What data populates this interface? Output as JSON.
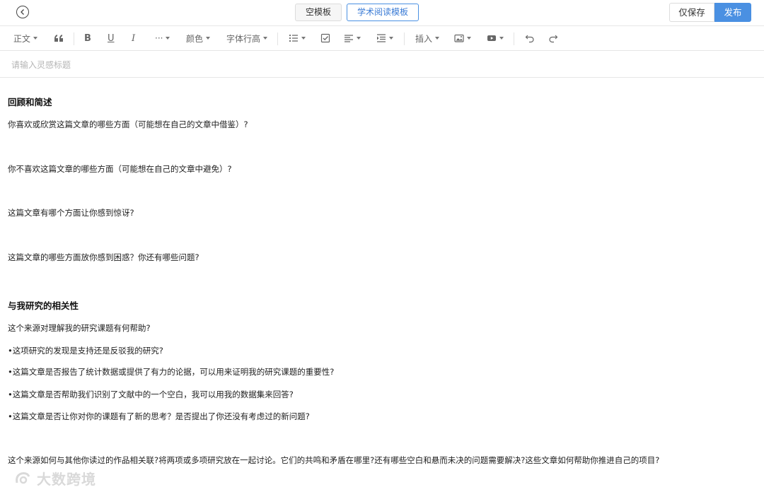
{
  "header": {
    "tabs": [
      {
        "label": "空模板",
        "active": false
      },
      {
        "label": "学术阅读模板",
        "active": true
      }
    ],
    "save_label": "仅保存",
    "publish_label": "发布"
  },
  "toolbar": {
    "paragraph_label": "正文",
    "more_label": "···",
    "color_label": "颜色",
    "line_height_label": "字体行高",
    "insert_label": "插入"
  },
  "editor": {
    "title_placeholder": "请输入灵感标题",
    "lines": [
      {
        "text": "回顾和简述",
        "heading": true
      },
      {
        "text": "你喜欢或欣赏这篇文章的哪些方面（可能想在自己的文章中借鉴）?",
        "heading": false
      },
      {
        "text": "你不喜欢这篇文章的哪些方面（可能想在自己的文章中避免）?",
        "heading": false
      },
      {
        "text": "这篇文章有哪个方面让你感到惊讶?",
        "heading": false
      },
      {
        "text": "这篇文章的哪些方面放你感到困惑？你还有哪些问题?",
        "heading": false
      },
      {
        "text": "与我研究的相关性",
        "heading": true
      },
      {
        "text": "这个来源对理解我的研究课题有何帮助?",
        "heading": false
      },
      {
        "text": "•这项研究的发现是支持还是反驳我的研究?",
        "heading": false
      },
      {
        "text": "•这篇文章是否报告了统计数据或提供了有力的论据，可以用来证明我的研究课题的重要性?",
        "heading": false
      },
      {
        "text": "•这篇文章是否帮助我们识别了文献中的一个空白，我可以用我的数据集来回答?",
        "heading": false
      },
      {
        "text": "•这篇文章是否让你对你的课题有了新的思考？是否提出了你还没有考虑过的新问题?",
        "heading": false
      },
      {
        "text": "这个来源如何与其他你读过的作品相关联?将两项或多项研究放在一起讨论。它们的共鸣和矛盾在哪里?还有哪些空白和悬而未决的问题需要解决?这些文章如何帮助你推进自己的项目?",
        "heading": false
      }
    ]
  },
  "watermark": {
    "text": "大数跨境"
  },
  "colors": {
    "accent": "#4a90e2",
    "border": "#e6e6e6",
    "placeholder": "#b5b5b5"
  }
}
